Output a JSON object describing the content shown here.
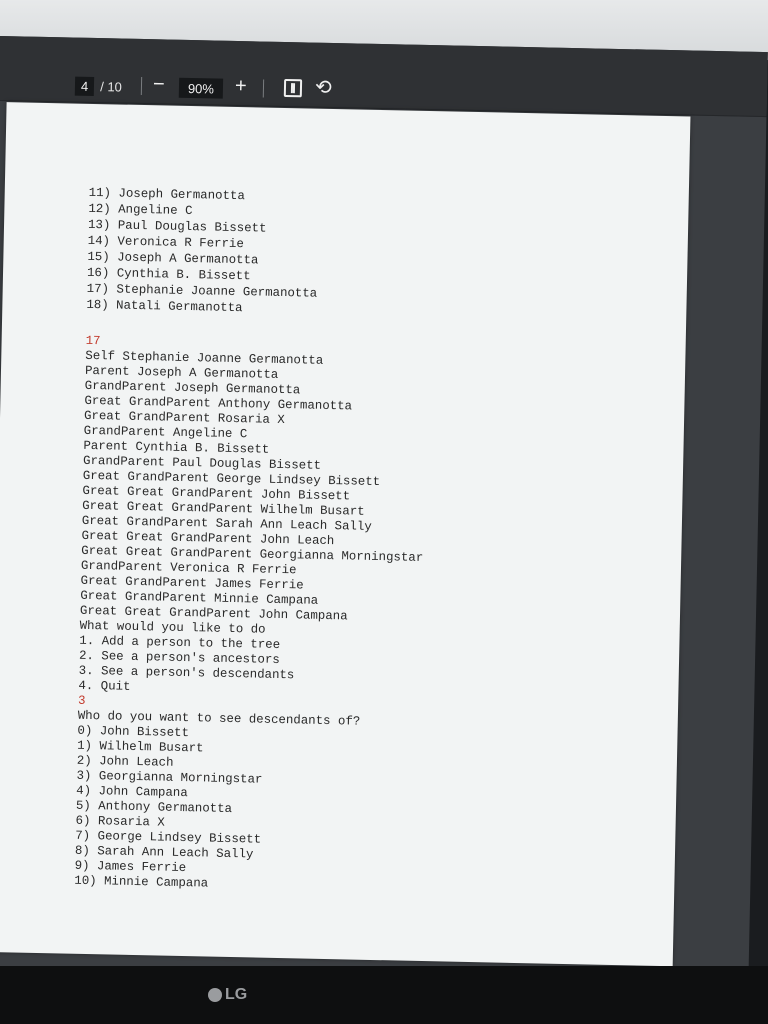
{
  "toolbar": {
    "current_page": "4",
    "total_pages": "/ 10",
    "zoom_out": "−",
    "zoom_level": "90%",
    "zoom_in": "+",
    "rotate_glyph": "⟲"
  },
  "document": {
    "menu_list": [
      "11) Joseph Germanotta",
      "12) Angeline C",
      "13) Paul Douglas Bissett",
      "14) Veronica R Ferrie",
      "15) Joseph A Germanotta",
      "16) Cynthia B. Bissett",
      "17) Stephanie Joanne Germanotta",
      "18) Natali Germanotta"
    ],
    "input_1": "17",
    "ancestors": [
      "Self Stephanie Joanne Germanotta",
      "Parent Joseph A Germanotta",
      "GrandParent Joseph Germanotta",
      "Great GrandParent Anthony Germanotta",
      "Great GrandParent Rosaria X",
      "GrandParent Angeline C",
      "Parent Cynthia B. Bissett",
      "GrandParent Paul Douglas Bissett",
      "Great GrandParent George Lindsey Bissett",
      "Great Great GrandParent John Bissett",
      "Great Great GrandParent Wilhelm Busart",
      "Great GrandParent Sarah Ann Leach Sally",
      "Great Great GrandParent John Leach",
      "Great Great GrandParent Georgianna Morningstar",
      "GrandParent Veronica R Ferrie",
      "Great GrandParent James Ferrie",
      "Great GrandParent Minnie Campana",
      "Great Great GrandParent John Campana"
    ],
    "menu": [
      "What would you like to do",
      "1. Add a person to the tree",
      "2. See a person's ancestors",
      "3. See a person's descendants",
      "4. Quit"
    ],
    "input_2": "3",
    "prompt": "Who do you want to see descendants of?",
    "descendant_options": [
      "0) John Bissett",
      "1) Wilhelm Busart",
      "2) John Leach",
      "3) Georgianna Morningstar",
      "4) John Campana",
      "5) Anthony Germanotta",
      "6) Rosaria X",
      "7) George Lindsey Bissett",
      "8) Sarah Ann Leach Sally",
      "9) James Ferrie",
      "10) Minnie Campana"
    ]
  },
  "monitor": {
    "brand": "LG"
  }
}
